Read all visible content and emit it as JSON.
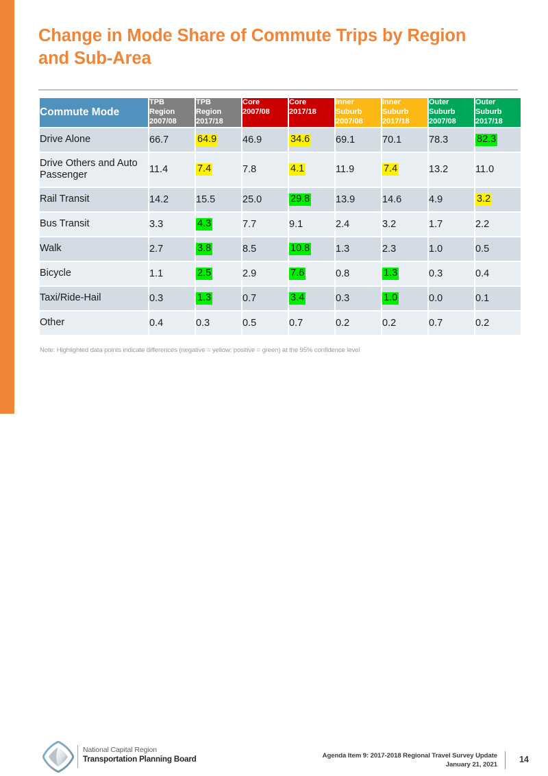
{
  "slide": {
    "title": "Change in Mode Share of Commute Trips by Region and Sub-Area",
    "accent_color": "#F08437"
  },
  "table": {
    "mode_header": "Commute Mode",
    "columns": [
      {
        "group": "TPB Region",
        "line1": "TPB",
        "line2": "Region",
        "period": "2007/08",
        "color": "#808080"
      },
      {
        "group": "TPB Region",
        "line1": "TPB",
        "line2": "Region",
        "period": "2017/18",
        "color": "#808080"
      },
      {
        "group": "Core",
        "line1": "Core",
        "line2": "",
        "period": "2007/08",
        "color": "#CC0000"
      },
      {
        "group": "Core",
        "line1": "Core",
        "line2": "",
        "period": "2017/18",
        "color": "#CC0000"
      },
      {
        "group": "Inner Suburb",
        "line1": "Inner",
        "line2": "Suburb",
        "period": "2007/08",
        "color": "#FCB814"
      },
      {
        "group": "Inner Suburb",
        "line1": "Inner",
        "line2": "Suburb",
        "period": "2017/18",
        "color": "#FCB814"
      },
      {
        "group": "Outer Suburb",
        "line1": "Outer",
        "line2": "Suburb",
        "period": "2007/08",
        "color": "#00A859"
      },
      {
        "group": "Outer Suburb",
        "line1": "Outer",
        "line2": "Suburb",
        "period": "2017/18",
        "color": "#00A859"
      }
    ],
    "rows": [
      {
        "mode": "Drive Alone",
        "values": [
          "66.7",
          "64.9",
          "46.9",
          "34.6",
          "69.1",
          "70.1",
          "78.3",
          "82.3"
        ],
        "highlights": [
          "",
          "yellow",
          "",
          "yellow",
          "",
          "",
          "",
          "green"
        ]
      },
      {
        "mode": "Drive Others and Auto Passenger",
        "values": [
          "11.4",
          "7.4",
          "7.8",
          "4.1",
          "11.9",
          "7.4",
          "13.2",
          "11.0"
        ],
        "highlights": [
          "",
          "yellow",
          "",
          "yellow",
          "",
          "yellow",
          "",
          ""
        ]
      },
      {
        "mode": "Rail Transit",
        "values": [
          "14.2",
          "15.5",
          "25.0",
          "29.8",
          "13.9",
          "14.6",
          "4.9",
          "3.2"
        ],
        "highlights": [
          "",
          "",
          "",
          "green",
          "",
          "",
          "",
          "yellow"
        ]
      },
      {
        "mode": "Bus Transit",
        "values": [
          "3.3",
          "4.3",
          "7.7",
          "9.1",
          "2.4",
          "3.2",
          "1.7",
          "2.2"
        ],
        "highlights": [
          "",
          "green",
          "",
          "",
          "",
          "",
          "",
          ""
        ]
      },
      {
        "mode": "Walk",
        "values": [
          "2.7",
          "3.8",
          "8.5",
          "10.8",
          "1.3",
          "2.3",
          "1.0",
          "0.5"
        ],
        "highlights": [
          "",
          "green",
          "",
          "green",
          "",
          "",
          "",
          ""
        ]
      },
      {
        "mode": "Bicycle",
        "values": [
          "1.1",
          "2.5",
          "2.9",
          "7.6",
          "0.8",
          "1.3",
          "0.3",
          "0.4"
        ],
        "highlights": [
          "",
          "green",
          "",
          "green",
          "",
          "green",
          "",
          ""
        ]
      },
      {
        "mode": "Taxi/Ride-Hail",
        "values": [
          "0.3",
          "1.3",
          "0.7",
          "3.4",
          "0.3",
          "1.0",
          "0.0",
          "0.1"
        ],
        "highlights": [
          "",
          "green",
          "",
          "green",
          "",
          "green",
          "",
          ""
        ]
      },
      {
        "mode": "Other",
        "values": [
          "0.4",
          "0.3",
          "0.5",
          "0.7",
          "0.2",
          "0.2",
          "0.7",
          "0.2"
        ],
        "highlights": [
          "",
          "",
          "",
          "",
          "",
          "",
          "",
          ""
        ]
      }
    ],
    "highlight_colors": {
      "yellow": "#FFF200",
      "green": "#00EE00"
    }
  },
  "note": "Note: Highlighted data points indicate differences (negative = yellow; positive = green) at the 95% confidence level",
  "footer": {
    "org_line1": "National Capital Region",
    "org_line2": "Transportation Planning Board",
    "agenda_line1": "Agenda Item 9: 2017-2018  Regional Travel Survey Update",
    "agenda_line2": "January 21, 2021",
    "page_number": "14"
  },
  "chart_data": {
    "type": "table",
    "title": "Change in Mode Share of Commute Trips by Region and Sub-Area",
    "units": "percent mode share",
    "categories": [
      "Drive Alone",
      "Drive Others and Auto Passenger",
      "Rail Transit",
      "Bus Transit",
      "Walk",
      "Bicycle",
      "Taxi/Ride-Hail",
      "Other"
    ],
    "series": [
      {
        "name": "TPB Region 2007/08",
        "values": [
          66.7,
          11.4,
          14.2,
          3.3,
          2.7,
          1.1,
          0.3,
          0.4
        ]
      },
      {
        "name": "TPB Region 2017/18",
        "values": [
          64.9,
          7.4,
          15.5,
          4.3,
          3.8,
          2.5,
          1.3,
          0.3
        ]
      },
      {
        "name": "Core 2007/08",
        "values": [
          46.9,
          7.8,
          25.0,
          7.7,
          8.5,
          2.9,
          0.7,
          0.5
        ]
      },
      {
        "name": "Core 2017/18",
        "values": [
          34.6,
          4.1,
          29.8,
          9.1,
          10.8,
          7.6,
          3.4,
          0.7
        ]
      },
      {
        "name": "Inner Suburb 2007/08",
        "values": [
          69.1,
          11.9,
          13.9,
          2.4,
          1.3,
          0.8,
          0.3,
          0.2
        ]
      },
      {
        "name": "Inner Suburb 2017/18",
        "values": [
          70.1,
          7.4,
          14.6,
          3.2,
          2.3,
          1.3,
          1.0,
          0.2
        ]
      },
      {
        "name": "Outer Suburb 2007/08",
        "values": [
          78.3,
          13.2,
          4.9,
          1.7,
          1.0,
          0.3,
          0.0,
          0.7
        ]
      },
      {
        "name": "Outer Suburb 2017/18",
        "values": [
          82.3,
          11.0,
          3.2,
          2.2,
          0.5,
          0.4,
          0.1,
          0.2
        ]
      }
    ],
    "annotations": [
      "Note: Highlighted data points indicate differences (negative = yellow; positive = green) at the 95% confidence level"
    ]
  }
}
